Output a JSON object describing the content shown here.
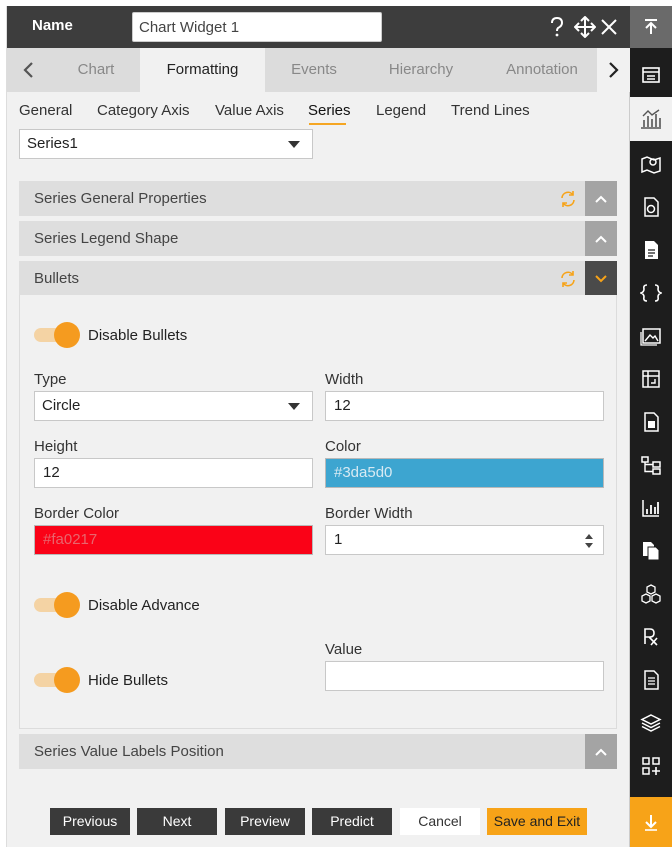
{
  "titlebar": {
    "name_label": "Name",
    "name_value": "Chart Widget 1",
    "icons": [
      "help-icon",
      "move-icon",
      "close-icon"
    ]
  },
  "tabs": [
    {
      "label": "Chart"
    },
    {
      "label": "Formatting",
      "active": true
    },
    {
      "label": "Events"
    },
    {
      "label": "Hierarchy"
    },
    {
      "label": "Annotation"
    }
  ],
  "subtabs": [
    {
      "label": "General"
    },
    {
      "label": "Category Axis"
    },
    {
      "label": "Value Axis"
    },
    {
      "label": "Series",
      "active": true
    },
    {
      "label": "Legend"
    },
    {
      "label": "Trend Lines"
    }
  ],
  "series_select": {
    "value": "Series1"
  },
  "sections": {
    "general": {
      "title": "Series General Properties"
    },
    "legend_shape": {
      "title": "Series Legend Shape"
    },
    "bullets": {
      "title": "Bullets"
    },
    "value_labels": {
      "title": "Series Value Labels Position"
    }
  },
  "bullets": {
    "disable_bullets": {
      "label": "Disable Bullets",
      "on": true
    },
    "type": {
      "label": "Type",
      "value": "Circle"
    },
    "width": {
      "label": "Width",
      "value": "12"
    },
    "height": {
      "label": "Height",
      "value": "12"
    },
    "color": {
      "label": "Color",
      "value": "#3da5d0",
      "swatch": "#3da5d0"
    },
    "border_color": {
      "label": "Border Color",
      "value": "#fa0217",
      "swatch": "#fa0217"
    },
    "border_width": {
      "label": "Border Width",
      "value": "1"
    },
    "disable_advance": {
      "label": "Disable Advance",
      "on": true
    },
    "hide_bullets": {
      "label": "Hide Bullets",
      "on": true
    },
    "value_field": {
      "label": "Value",
      "value": ""
    }
  },
  "footer": {
    "previous": "Previous",
    "next": "Next",
    "preview": "Preview",
    "predict": "Predict",
    "cancel": "Cancel",
    "save_exit": "Save and Exit"
  },
  "colors": {
    "accent": "#f7a318",
    "dark": "#3d3d3d",
    "sidebar": "#1d1d1d"
  }
}
